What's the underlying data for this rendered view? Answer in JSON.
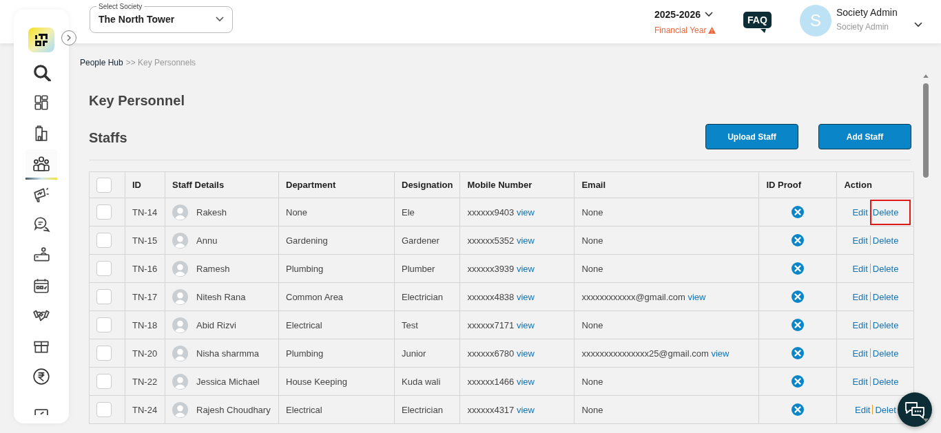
{
  "header": {
    "society_select": {
      "label": "Select Society",
      "value": "The North Tower"
    },
    "year": {
      "value": "2025-2026",
      "caption": "Financial Year"
    },
    "faq": "FAQ",
    "user": {
      "initial": "S",
      "name": "Society Admin",
      "role": "Society Admin"
    }
  },
  "sidebar": {
    "items": [
      {
        "kind": "search",
        "selected": false
      },
      {
        "kind": "dashboard",
        "selected": false
      },
      {
        "kind": "building",
        "selected": false
      },
      {
        "kind": "people",
        "selected": true
      },
      {
        "kind": "megaphone",
        "selected": false
      },
      {
        "kind": "chat",
        "selected": false
      },
      {
        "kind": "desk",
        "selected": false
      },
      {
        "kind": "calendar",
        "selected": false
      },
      {
        "kind": "handshake",
        "selected": false
      },
      {
        "kind": "box",
        "selected": false
      },
      {
        "kind": "rupee",
        "selected": false
      },
      {
        "kind": "partial",
        "selected": false
      }
    ]
  },
  "breadcrumb": [
    {
      "label": "People Hub",
      "kind": "link"
    },
    {
      "label": ">> Key Personnels",
      "kind": "current"
    }
  ],
  "page_title": "Key Personnel",
  "section_title": "Staffs",
  "actions": [
    "Upload Staff",
    "Add Staff"
  ],
  "table": {
    "all_checked": false,
    "columns": [
      "ID",
      "Staff Details",
      "Department",
      "Designation",
      "Mobile Number",
      "Email",
      "ID Proof",
      "Action"
    ],
    "rows": [
      {
        "checked": false,
        "id": "TN-14",
        "name": "Rakesh",
        "department": "None",
        "designation": "Ele",
        "mobile": "xxxxxx9403",
        "mobile_link": "view",
        "email": "None",
        "id_proof_uploaded": false,
        "edit": "Edit",
        "delete": "Delete",
        "highlighted": true
      },
      {
        "checked": false,
        "id": "TN-15",
        "name": "Annu",
        "department": "Gardening",
        "designation": "Gardener",
        "mobile": "xxxxxx5352",
        "mobile_link": "view",
        "email": "None",
        "id_proof_uploaded": false,
        "edit": "Edit",
        "delete": "Delete",
        "highlighted": false
      },
      {
        "checked": false,
        "id": "TN-16",
        "name": "Ramesh",
        "department": "Plumbing",
        "designation": "Plumber",
        "mobile": "xxxxxx3939",
        "mobile_link": "view",
        "email": "None",
        "id_proof_uploaded": false,
        "edit": "Edit",
        "delete": "Delete",
        "highlighted": false
      },
      {
        "checked": false,
        "id": "TN-17",
        "name": "Nitesh Rana",
        "department": "Common Area",
        "designation": "Electrician",
        "mobile": "xxxxxx4838",
        "mobile_link": "view",
        "email": "xxxxxxxxxxxx@gmail.com",
        "email_link": "view",
        "id_proof_uploaded": false,
        "edit": "Edit",
        "delete": "Delete",
        "highlighted": false
      },
      {
        "checked": false,
        "id": "TN-18",
        "name": "Abid Rizvi",
        "department": "Electrical",
        "designation": "Test",
        "mobile": "xxxxxx7171",
        "mobile_link": "view",
        "email": "None",
        "id_proof_uploaded": false,
        "edit": "Edit",
        "delete": "Delete",
        "highlighted": false
      },
      {
        "checked": false,
        "id": "TN-20",
        "name": "Nisha sharmma",
        "department": "Plumbing",
        "designation": "Junior",
        "mobile": "xxxxxx6780",
        "mobile_link": "view",
        "email": "xxxxxxxxxxxxxxx25@gmail.com",
        "email_link": "view",
        "id_proof_uploaded": false,
        "edit": "Edit",
        "delete": "Delete",
        "highlighted": false
      },
      {
        "checked": false,
        "id": "TN-22",
        "name": "Jessica Michael",
        "department": "House Keeping",
        "designation": "Kuda wali",
        "mobile": "xxxxxx1466",
        "mobile_link": "view",
        "email": "None",
        "id_proof_uploaded": false,
        "edit": "Edit",
        "delete": "Delete",
        "highlighted": false
      },
      {
        "checked": false,
        "id": "TN-24",
        "name": "Rajesh Choudhary",
        "department": "Electrical",
        "designation": "Electrician",
        "mobile": "xxxxxx4317",
        "mobile_link": "view",
        "email": "None",
        "id_proof_uploaded": false,
        "edit": "Edit",
        "delete": "Delet",
        "highlighted": false
      }
    ]
  }
}
